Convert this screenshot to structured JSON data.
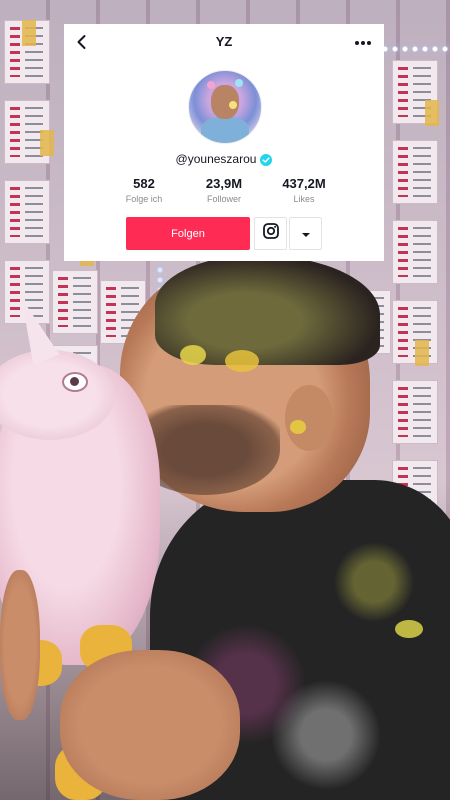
{
  "profile": {
    "title": "YZ",
    "username": "@youneszarou",
    "verified": true,
    "stats": [
      {
        "value": "582",
        "label": "Folge ich"
      },
      {
        "value": "23,9M",
        "label": "Follower"
      },
      {
        "value": "437,2M",
        "label": "Likes"
      }
    ],
    "follow_label": "Folgen",
    "accent_color": "#fe2c55",
    "verified_color": "#20d5ec"
  },
  "icons": {
    "back": "chevron-left-icon",
    "more": "more-horizontal-icon",
    "verified": "verified-badge-icon",
    "instagram": "instagram-icon",
    "dropdown": "caret-down-icon"
  }
}
